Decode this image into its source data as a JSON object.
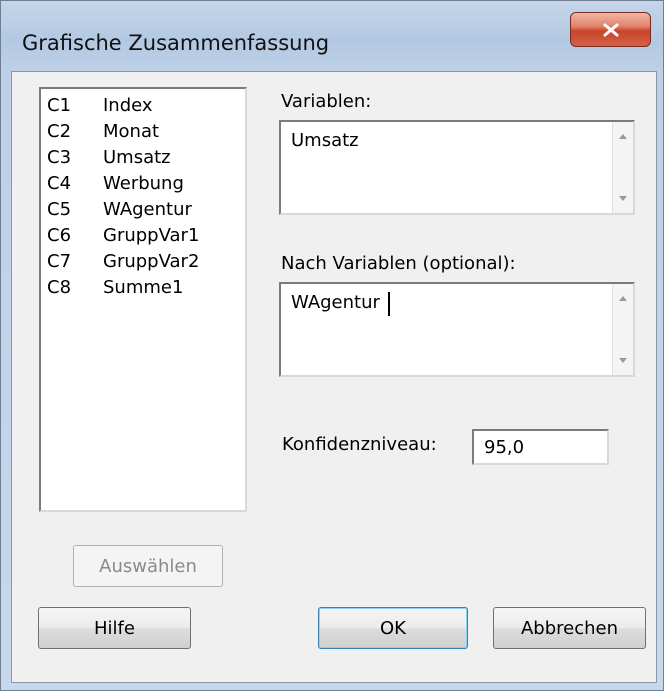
{
  "window": {
    "title": "Grafische Zusammenfassung"
  },
  "columns": [
    {
      "id": "C1",
      "name": "Index"
    },
    {
      "id": "C2",
      "name": "Monat"
    },
    {
      "id": "C3",
      "name": "Umsatz"
    },
    {
      "id": "C4",
      "name": "Werbung"
    },
    {
      "id": "C5",
      "name": "WAgentur"
    },
    {
      "id": "C6",
      "name": "GruppVar1"
    },
    {
      "id": "C7",
      "name": "GruppVar2"
    },
    {
      "id": "C8",
      "name": "Summe1"
    }
  ],
  "variables": {
    "label": "Variablen:",
    "value": "Umsatz"
  },
  "by_variables": {
    "label": "Nach Variablen (optional):",
    "value": "WAgentur"
  },
  "confidence": {
    "label": "Konfidenzniveau:",
    "value": "95,0"
  },
  "buttons": {
    "select": "Auswählen",
    "help": "Hilfe",
    "ok": "OK",
    "cancel": "Abbrechen"
  }
}
